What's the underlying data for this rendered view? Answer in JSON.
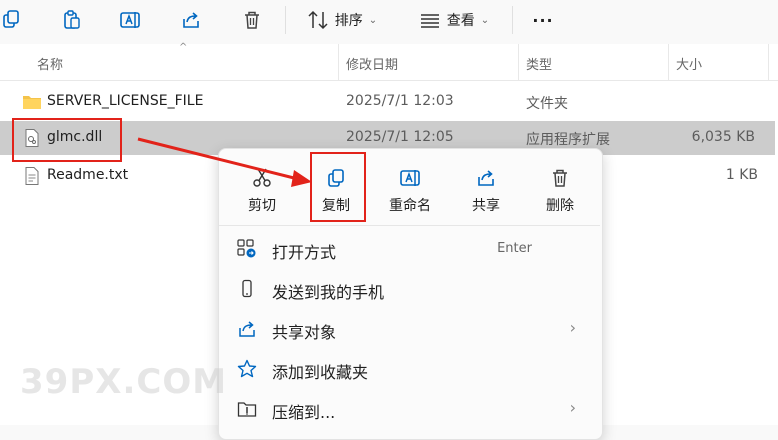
{
  "toolbar": {
    "sort_label": "排序",
    "view_label": "查看",
    "more_label": "···"
  },
  "header": {
    "name": "名称",
    "date": "修改日期",
    "type": "类型",
    "size": "大小"
  },
  "files": [
    {
      "name": "SERVER_LICENSE_FILE",
      "date": "2025/7/1 12:03",
      "type": "文件夹",
      "size": "",
      "icon": "folder-icon"
    },
    {
      "name": "glmc.dll",
      "date": "2025/7/1 12:05",
      "type": "应用程序扩展",
      "size": "6,035 KB",
      "icon": "dll-file-icon"
    },
    {
      "name": "Readme.txt",
      "date": "",
      "type": "",
      "size": "1 KB",
      "icon": "text-file-icon"
    }
  ],
  "context_menu": {
    "quick_actions": [
      "剪切",
      "复制",
      "重命名",
      "共享",
      "删除"
    ],
    "items": [
      {
        "label": "打开方式",
        "shortcut": "Enter",
        "icon": "open-with-icon"
      },
      {
        "label": "发送到我的手机",
        "shortcut": "",
        "icon": "phone-icon"
      },
      {
        "label": "共享对象",
        "shortcut": "",
        "submenu": "›",
        "icon": "share-icon"
      },
      {
        "label": "添加到收藏夹",
        "shortcut": "",
        "icon": "star-icon"
      },
      {
        "label": "压缩到...",
        "shortcut": "",
        "submenu": "›",
        "icon": "zip-folder-icon"
      }
    ]
  },
  "watermark": "39PX.COM",
  "colors": {
    "highlight": "#e2231a",
    "selected_row": "#cccccc",
    "accent": "#0067c0"
  }
}
